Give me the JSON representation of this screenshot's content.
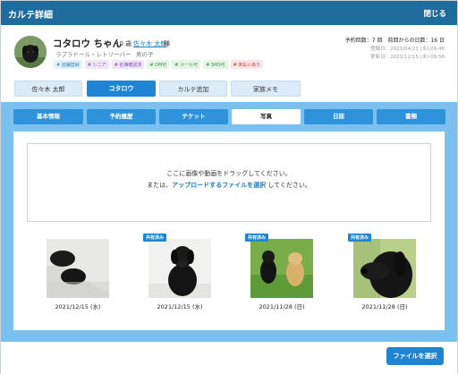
{
  "header": {
    "title": "カルテ詳細",
    "close_label": "閉じる"
  },
  "profile": {
    "name": "コタロウ ちゃん",
    "age": "10 歳",
    "owner": "佐々木 太郎",
    "honorific": "様",
    "breed": "ラブラドール・レトリーバー",
    "sex": "男の子",
    "tags": [
      {
        "label": "# 店舗登録",
        "bg": "#e3f1fb",
        "fg": "#2a7cb8"
      },
      {
        "label": "# シニア",
        "bg": "#efe6f8",
        "fg": "#7d4fb0"
      },
      {
        "label": "# 名簿確認済",
        "bg": "#efe6f8",
        "fg": "#7d4fb0"
      },
      {
        "label": "# DM可",
        "bg": "#e6f5e7",
        "fg": "#3b8e44"
      },
      {
        "label": "# メール可",
        "bg": "#e6f5e7",
        "fg": "#3b8e44"
      },
      {
        "label": "# SMS可",
        "bg": "#e6f5e7",
        "fg": "#3b8e44"
      },
      {
        "label": "# 未払いあり",
        "bg": "#fbe6e6",
        "fg": "#c23b3b"
      }
    ]
  },
  "stats": {
    "summary": "予約回数：7 回　前回からの日数：16 日",
    "registered": "登録日：2021/04/21 (水) 09:46",
    "updated": "更新日：2021/12/15 (水) 09:56"
  },
  "top_buttons": [
    "佐々木 太郎",
    "コタロウ",
    "カルテ追加",
    "家族メモ"
  ],
  "tabs": [
    "基本情報",
    "予約履歴",
    "チケット",
    "写真",
    "日誌",
    "書類"
  ],
  "dropzone": {
    "line1": "ここに画像や動画をドラッグしてください。",
    "line2_prefix": "または、",
    "line2_link": "アップロードするファイルを選択",
    "line2_suffix": "してください。"
  },
  "photos": [
    {
      "date": "2021/12/15 (水)",
      "badge": "",
      "icon": "dog-paws-photo"
    },
    {
      "date": "2021/12/15 (水)",
      "badge": "共有済み",
      "icon": "dog-sitting-photo"
    },
    {
      "date": "2021/11/28 (日)",
      "badge": "共有済み",
      "icon": "two-dogs-photo"
    },
    {
      "date": "2021/11/28 (日)",
      "badge": "共有済み",
      "icon": "dog-portrait-photo"
    }
  ],
  "footer": {
    "select_file_label": "ファイルを選択"
  },
  "colors": {
    "primary": "#1f84d2",
    "header": "#1e6b9c",
    "panel": "#7cc0ef"
  }
}
